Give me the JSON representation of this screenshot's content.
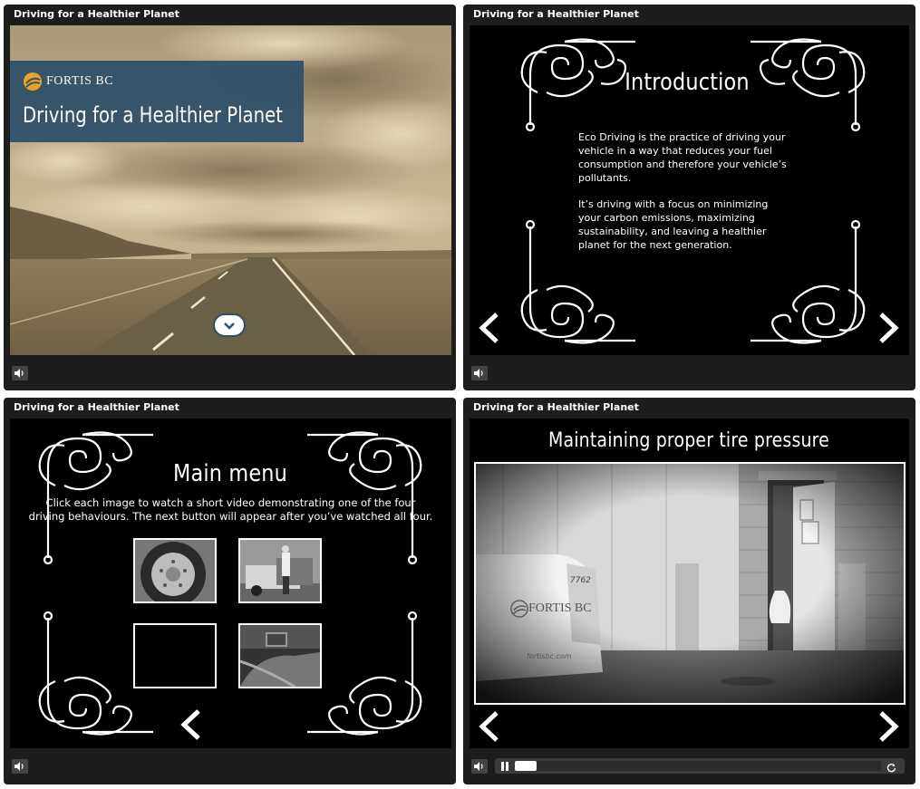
{
  "panels": {
    "p1": {
      "title": "Driving for a Healthier Planet",
      "brand": "FORTIS BC",
      "headline": "Driving for a Healthier Planet"
    },
    "p2": {
      "title": "Driving for a Healthier Planet",
      "heading": "Introduction",
      "paragraphs": [
        "Eco Driving is the practice of driving your vehicle in a way that reduces your fuel consumption and therefore your vehicle’s pollutants.",
        "It’s driving with a focus on minimizing your carbon emissions, maximizing sustainability, and leaving a healthier planet for the next generation."
      ]
    },
    "p3": {
      "title": "Driving for a Healthier Planet",
      "heading": "Main menu",
      "instructions_line1": "Click each image to watch a short video demonstrating one of the four",
      "instructions_line2": "driving behaviours. The next button will appear after you’ve watched all four."
    },
    "p4": {
      "title": "Driving for a Healthier Planet",
      "heading": "Maintaining proper tire pressure",
      "video_brand": "FORTIS BC",
      "video_url_text": "fortisbc.com",
      "truck_number": "7762",
      "progress": 0.06
    }
  },
  "colors": {
    "banner": "#2d4f6a",
    "accent": "#f2a21c",
    "sepia": "#9a8a66"
  }
}
